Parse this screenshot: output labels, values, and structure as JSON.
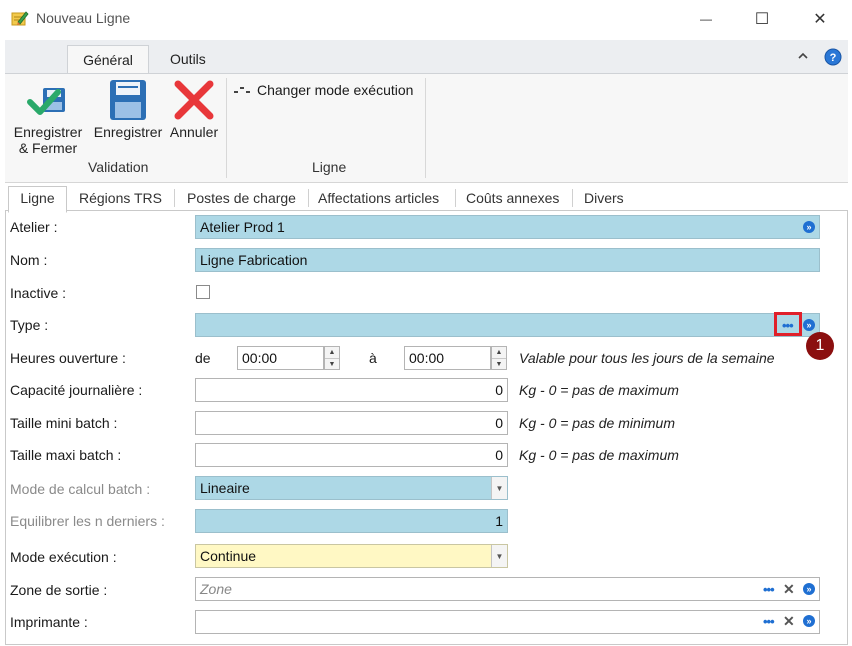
{
  "window": {
    "title": "Nouveau Ligne",
    "minimize_glyph": "—",
    "maximize_glyph": "☐",
    "close_glyph": "✕"
  },
  "ribbon": {
    "tabs": [
      {
        "label": "Général",
        "active": true
      },
      {
        "label": "Outils",
        "active": false
      }
    ],
    "buttons": {
      "save_close": "Enregistrer\n& Fermer",
      "save": "Enregistrer",
      "cancel": "Annuler",
      "change_mode": "Changer mode exécution"
    },
    "groups": {
      "validation": "Validation",
      "ligne": "Ligne"
    }
  },
  "form_tabs": [
    {
      "label": "Ligne",
      "active": true
    },
    {
      "label": "Régions TRS",
      "active": false
    },
    {
      "label": "Postes de charge",
      "active": false
    },
    {
      "label": "Affectations articles",
      "active": false
    },
    {
      "label": "Coûts annexes",
      "active": false
    },
    {
      "label": "Divers",
      "active": false
    }
  ],
  "form": {
    "atelier": {
      "label": "Atelier :",
      "value": "Atelier Prod 1"
    },
    "nom": {
      "label": "Nom :",
      "value": "Ligne Fabrication"
    },
    "inactive": {
      "label": "Inactive :",
      "checked": false
    },
    "type": {
      "label": "Type :",
      "value": ""
    },
    "heures": {
      "label": "Heures ouverture :",
      "de_label": "de",
      "de_value": "00:00",
      "a_label": "à",
      "a_value": "00:00",
      "hint": "Valable pour tous les jours de la semaine"
    },
    "capacite": {
      "label": "Capacité journalière :",
      "value": "0",
      "hint": "Kg - 0 = pas de maximum"
    },
    "mini_batch": {
      "label": "Taille mini batch :",
      "value": "0",
      "hint": "Kg - 0 = pas de minimum"
    },
    "maxi_batch": {
      "label": "Taille maxi batch :",
      "value": "0",
      "hint": "Kg - 0 = pas de maximum"
    },
    "mode_calcul": {
      "label": "Mode de calcul batch :",
      "value": "Lineaire"
    },
    "equilibrer": {
      "label": "Equilibrer les n derniers :",
      "value": "1"
    },
    "mode_execution": {
      "label": "Mode exécution :",
      "value": "Continue"
    },
    "zone_sortie": {
      "label": "Zone de sortie :",
      "value": "",
      "placeholder": "Zone"
    },
    "imprimante": {
      "label": "Imprimante :",
      "value": ""
    }
  },
  "annotation": {
    "number": "1",
    "color": "#8b0f0f",
    "highlight_color": "#e0202a"
  },
  "colors": {
    "field_blue": "#add8e6",
    "field_yellow": "#fff8c4",
    "icon_blue": "#1f6fd2"
  }
}
